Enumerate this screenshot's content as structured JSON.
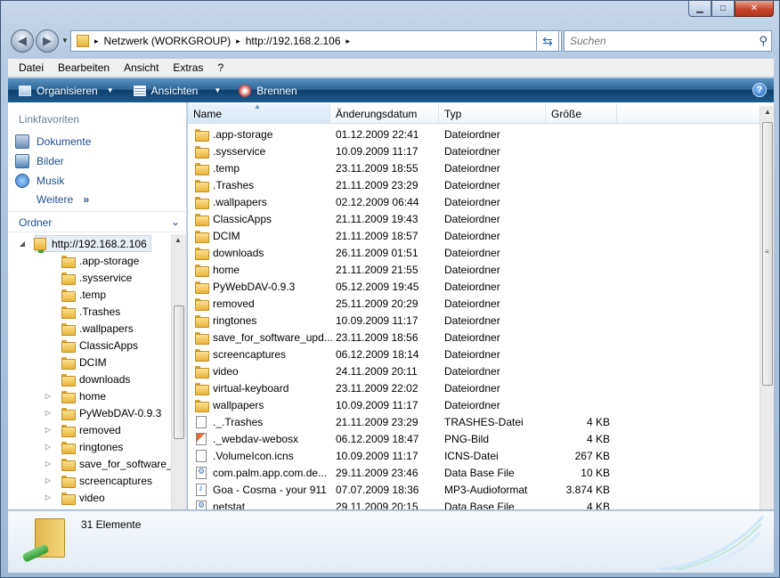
{
  "window": {
    "minimize_glyph": "▁",
    "maximize_glyph": "□",
    "close_glyph": "✕"
  },
  "address": {
    "segments": [
      "Netzwerk (WORKGROUP)",
      "http://192.168.2.106"
    ],
    "separator": "▸"
  },
  "search": {
    "placeholder": "Suchen"
  },
  "menu": [
    "Datei",
    "Bearbeiten",
    "Ansicht",
    "Extras",
    "?"
  ],
  "commands": {
    "organize": "Organisieren",
    "views": "Ansichten",
    "burn": "Brennen"
  },
  "nav": {
    "favorites_title": "Linkfavoriten",
    "favorites": [
      {
        "label": "Dokumente",
        "icon": "documents-icon",
        "color": "#6e8fb9"
      },
      {
        "label": "Bilder",
        "icon": "pictures-icon",
        "color": "#4f84b9"
      },
      {
        "label": "Musik",
        "icon": "music-icon",
        "color": "#3d7cc4"
      }
    ],
    "more": "Weitere",
    "more_glyph": "»",
    "folders_title": "Ordner",
    "tree_root": "http://192.168.2.106",
    "tree": [
      {
        "label": ".app-storage",
        "expandable": false
      },
      {
        "label": ".sysservice",
        "expandable": false
      },
      {
        "label": ".temp",
        "expandable": false
      },
      {
        "label": ".Trashes",
        "expandable": false
      },
      {
        "label": ".wallpapers",
        "expandable": false
      },
      {
        "label": "ClassicApps",
        "expandable": false
      },
      {
        "label": "DCIM",
        "expandable": false
      },
      {
        "label": "downloads",
        "expandable": false
      },
      {
        "label": "home",
        "expandable": true
      },
      {
        "label": "PyWebDAV-0.9.3",
        "expandable": true
      },
      {
        "label": "removed",
        "expandable": true
      },
      {
        "label": "ringtones",
        "expandable": true
      },
      {
        "label": "save_for_software_up",
        "expandable": true
      },
      {
        "label": "screencaptures",
        "expandable": true
      },
      {
        "label": "video",
        "expandable": true
      }
    ]
  },
  "columns": {
    "name": "Name",
    "date": "Änderungsdatum",
    "type": "Typ",
    "size": "Größe"
  },
  "files": [
    {
      "name": ".app-storage",
      "date": "01.12.2009 22:41",
      "type": "Dateiordner",
      "size": "",
      "kind": "folder"
    },
    {
      "name": ".sysservice",
      "date": "10.09.2009 11:17",
      "type": "Dateiordner",
      "size": "",
      "kind": "folder"
    },
    {
      "name": ".temp",
      "date": "23.11.2009 18:55",
      "type": "Dateiordner",
      "size": "",
      "kind": "folder"
    },
    {
      "name": ".Trashes",
      "date": "21.11.2009 23:29",
      "type": "Dateiordner",
      "size": "",
      "kind": "folder"
    },
    {
      "name": ".wallpapers",
      "date": "02.12.2009 06:44",
      "type": "Dateiordner",
      "size": "",
      "kind": "folder"
    },
    {
      "name": "ClassicApps",
      "date": "21.11.2009 19:43",
      "type": "Dateiordner",
      "size": "",
      "kind": "folder"
    },
    {
      "name": "DCIM",
      "date": "21.11.2009 18:57",
      "type": "Dateiordner",
      "size": "",
      "kind": "folder"
    },
    {
      "name": "downloads",
      "date": "26.11.2009 01:51",
      "type": "Dateiordner",
      "size": "",
      "kind": "folder"
    },
    {
      "name": "home",
      "date": "21.11.2009 21:55",
      "type": "Dateiordner",
      "size": "",
      "kind": "folder"
    },
    {
      "name": "PyWebDAV-0.9.3",
      "date": "05.12.2009 19:45",
      "type": "Dateiordner",
      "size": "",
      "kind": "folder"
    },
    {
      "name": "removed",
      "date": "25.11.2009 20:29",
      "type": "Dateiordner",
      "size": "",
      "kind": "folder"
    },
    {
      "name": "ringtones",
      "date": "10.09.2009 11:17",
      "type": "Dateiordner",
      "size": "",
      "kind": "folder"
    },
    {
      "name": "save_for_software_upd...",
      "date": "23.11.2009 18:56",
      "type": "Dateiordner",
      "size": "",
      "kind": "folder"
    },
    {
      "name": "screencaptures",
      "date": "06.12.2009 18:14",
      "type": "Dateiordner",
      "size": "",
      "kind": "folder"
    },
    {
      "name": "video",
      "date": "24.11.2009 20:11",
      "type": "Dateiordner",
      "size": "",
      "kind": "folder"
    },
    {
      "name": "virtual-keyboard",
      "date": "23.11.2009 22:02",
      "type": "Dateiordner",
      "size": "",
      "kind": "folder"
    },
    {
      "name": "wallpapers",
      "date": "10.09.2009 11:17",
      "type": "Dateiordner",
      "size": "",
      "kind": "folder"
    },
    {
      "name": "._.Trashes",
      "date": "21.11.2009 23:29",
      "type": "TRASHES-Datei",
      "size": "4 KB",
      "kind": "file"
    },
    {
      "name": "._webdav-webosx",
      "date": "06.12.2009 18:47",
      "type": "PNG-Bild",
      "size": "4 KB",
      "kind": "png"
    },
    {
      "name": ".VolumeIcon.icns",
      "date": "10.09.2009 11:17",
      "type": "ICNS-Datei",
      "size": "267 KB",
      "kind": "file"
    },
    {
      "name": "com.palm.app.com.de...",
      "date": "29.11.2009 23:46",
      "type": "Data Base File",
      "size": "10 KB",
      "kind": "db"
    },
    {
      "name": "Goa - Cosma - your 911",
      "date": "07.07.2009 18:36",
      "type": "MP3-Audioformat",
      "size": "3.874 KB",
      "kind": "mp3"
    },
    {
      "name": "netstat",
      "date": "29.11.2009 20:15",
      "type": "Data Base File",
      "size": "4 KB",
      "kind": "db"
    }
  ],
  "status": {
    "count": "31 Elemente"
  }
}
